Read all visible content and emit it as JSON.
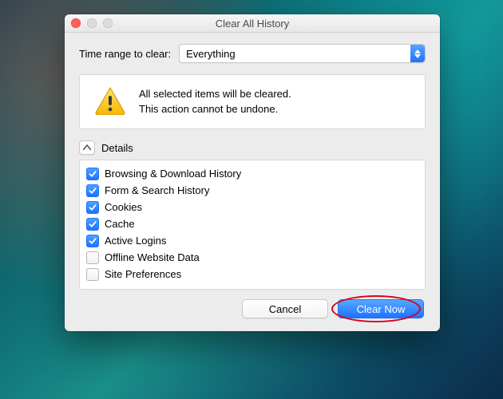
{
  "window": {
    "title": "Clear All History"
  },
  "range": {
    "label": "Time range to clear:",
    "selected": "Everything"
  },
  "warning": {
    "line1": "All selected items will be cleared.",
    "line2": "This action cannot be undone."
  },
  "details": {
    "label": "Details",
    "items": [
      {
        "label": "Browsing & Download History",
        "checked": true
      },
      {
        "label": "Form & Search History",
        "checked": true
      },
      {
        "label": "Cookies",
        "checked": true
      },
      {
        "label": "Cache",
        "checked": true
      },
      {
        "label": "Active Logins",
        "checked": true
      },
      {
        "label": "Offline Website Data",
        "checked": false
      },
      {
        "label": "Site Preferences",
        "checked": false
      }
    ]
  },
  "actions": {
    "cancel": "Cancel",
    "clear": "Clear Now"
  }
}
